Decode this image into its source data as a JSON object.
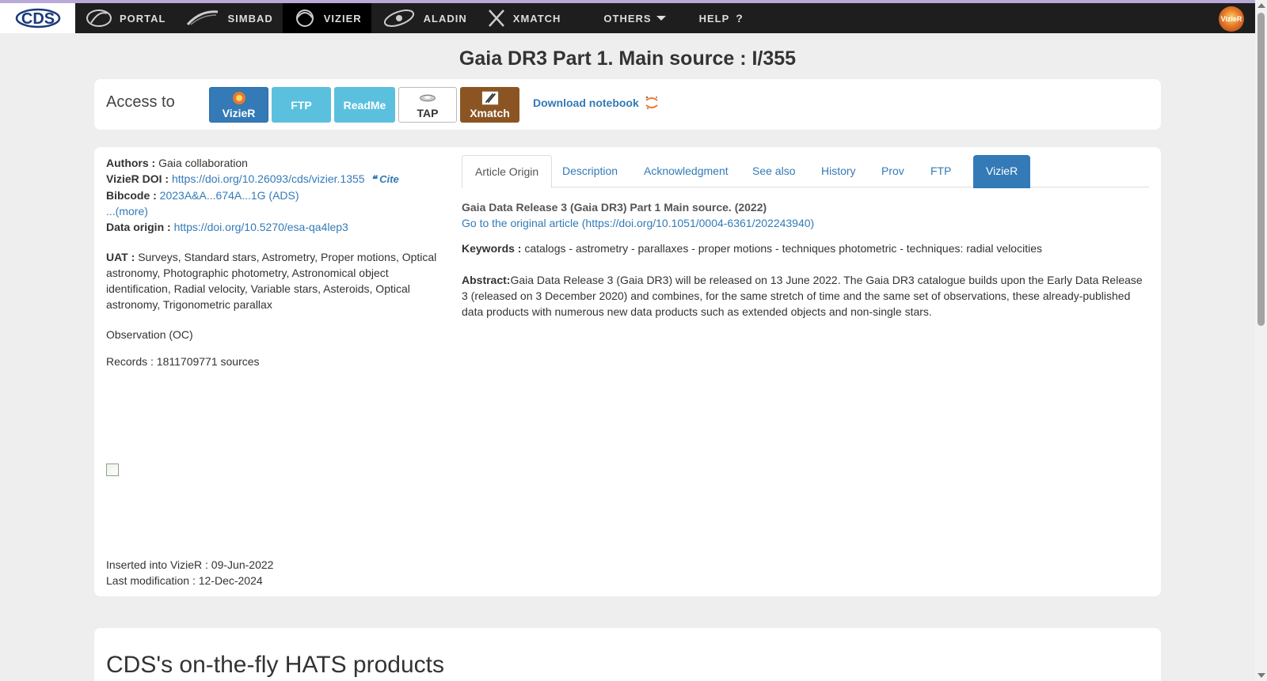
{
  "nav": {
    "items": [
      {
        "label": "Portal"
      },
      {
        "label": "Simbad"
      },
      {
        "label": "VizieR"
      },
      {
        "label": "Aladin"
      },
      {
        "label": "XMatch"
      },
      {
        "label": "Others"
      },
      {
        "label": "Help"
      }
    ],
    "help_icon": "?",
    "logo_text": "CDS",
    "vizier_badge": "VizieR"
  },
  "page": {
    "title": "Gaia DR3 Part 1. Main source : I/355"
  },
  "access": {
    "label": "Access to",
    "buttons": {
      "vizier": "VizieR",
      "ftp": "FTP",
      "readme": "ReadMe",
      "tap": "TAP",
      "xmatch": "Xmatch"
    },
    "download_notebook": "Download notebook"
  },
  "meta": {
    "authors_label": "Authors :",
    "authors": "Gaia collaboration",
    "doi_label": "VizieR DOI :",
    "doi": "https://doi.org/10.26093/cds/vizier.1355",
    "cite": "Cite",
    "bibcode_label": "Bibcode :",
    "bibcode": "2023A&A...674A...1G (ADS)",
    "more": "...(more)",
    "origin_label": "Data origin :",
    "origin": "https://doi.org/10.5270/esa-qa4lep3",
    "uat_label": "UAT :",
    "uat": "Surveys, Standard stars, Astrometry, Proper motions, Optical astronomy, Photographic photometry, Astronomical object identification, Radial velocity, Variable stars, Asteroids, Optical astronomy, Trigonometric parallax",
    "observation": "Observation (OC)",
    "records": "Records : 1811709771 sources",
    "inserted": "Inserted into VizieR : 09-Jun-2022",
    "modified": "Last modification : 12-Dec-2024"
  },
  "tabs": [
    {
      "label": "Article Origin"
    },
    {
      "label": "Description"
    },
    {
      "label": "Acknowledgment"
    },
    {
      "label": "See also"
    },
    {
      "label": "History"
    },
    {
      "label": "Prov"
    },
    {
      "label": "FTP"
    },
    {
      "label": "VizieR"
    }
  ],
  "article": {
    "title": "Gaia Data Release 3 (Gaia DR3) Part 1 Main source. (2022)",
    "link": "Go to the original article (https://doi.org/10.1051/0004-6361/202243940)",
    "keywords_label": "Keywords :",
    "keywords": "catalogs - astrometry - parallaxes - proper motions - techniques photometric - techniques: radial velocities",
    "abstract_label": "Abstract:",
    "abstract": "Gaia Data Release 3 (Gaia DR3) will be released on 13 June 2022. The Gaia DR3 catalogue builds upon the Early Data Release 3 (released on 3 December 2020) and combines, for the same stretch of time and the same set of observations, these already-published data products with numerous new data products such as extended objects and non-single stars."
  },
  "hats": {
    "title": "CDS's on-the-fly HATS products"
  },
  "colors": {
    "primary": "#337ab7",
    "info": "#5bc0de",
    "xmatch": "#8b5523",
    "nav_bg": "#1e1e1e"
  }
}
